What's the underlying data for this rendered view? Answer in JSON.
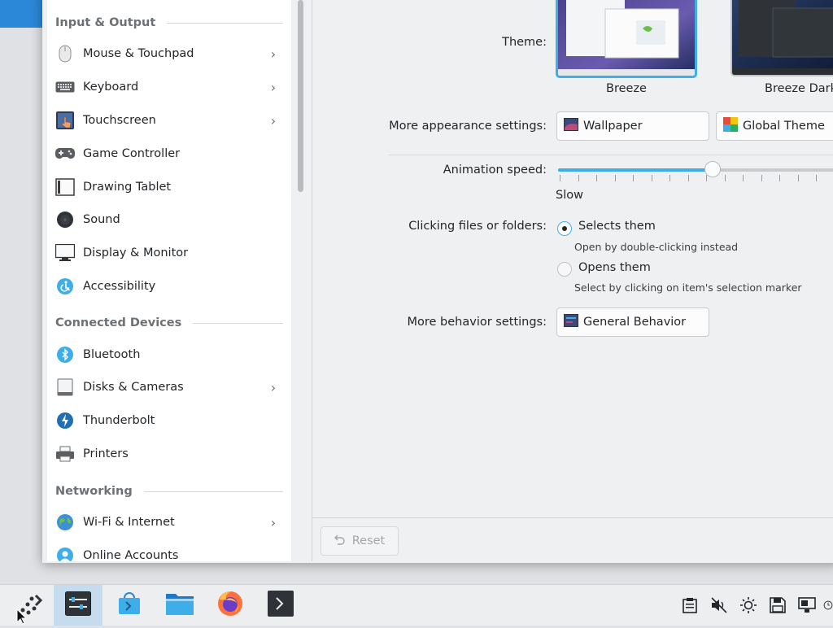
{
  "sidebar": {
    "sections": [
      {
        "title": "Input & Output"
      },
      {
        "title": "Connected Devices"
      },
      {
        "title": "Networking"
      }
    ],
    "items": [
      {
        "label": "Mouse & Touchpad",
        "icon": "mouse-icon",
        "has_children": true
      },
      {
        "label": "Keyboard",
        "icon": "keyboard-icon",
        "has_children": true
      },
      {
        "label": "Touchscreen",
        "icon": "touchscreen-icon",
        "has_children": true
      },
      {
        "label": "Game Controller",
        "icon": "gamepad-icon",
        "has_children": false
      },
      {
        "label": "Drawing Tablet",
        "icon": "tablet-icon",
        "has_children": false
      },
      {
        "label": "Sound",
        "icon": "speaker-icon",
        "has_children": false
      },
      {
        "label": "Display & Monitor",
        "icon": "monitor-icon",
        "has_children": false
      },
      {
        "label": "Accessibility",
        "icon": "accessibility-icon",
        "has_children": false
      },
      {
        "label": "Bluetooth",
        "icon": "bluetooth-icon",
        "has_children": false
      },
      {
        "label": "Disks & Cameras",
        "icon": "disk-icon",
        "has_children": true
      },
      {
        "label": "Thunderbolt",
        "icon": "thunderbolt-icon",
        "has_children": false
      },
      {
        "label": "Printers",
        "icon": "printer-icon",
        "has_children": false
      },
      {
        "label": "Wi-Fi & Internet",
        "icon": "globe-icon",
        "has_children": true
      },
      {
        "label": "Online Accounts",
        "icon": "accounts-icon",
        "has_children": false
      }
    ]
  },
  "main": {
    "theme_label": "Theme:",
    "themes": [
      {
        "name": "Breeze",
        "selected": true
      },
      {
        "name": "Breeze Dark",
        "selected": false
      }
    ],
    "more_appearance_label": "More appearance settings:",
    "wallpaper_button": "Wallpaper",
    "global_theme_button": "Global Theme",
    "animation_label": "Animation speed:",
    "animation_slow": "Slow",
    "animation_level": 0.55,
    "clicking_label": "Clicking files or folders:",
    "option_selects": "Selects them",
    "option_selects_hint": "Open by double-clicking instead",
    "option_opens": "Opens them",
    "option_opens_hint": "Select by clicking on item's selection marker",
    "selected_option": "selects",
    "more_behavior_label": "More behavior settings:",
    "general_behavior_button": "General Behavior"
  },
  "footer": {
    "reset_label": "Reset"
  },
  "taskbar": {
    "apps": [
      "application-launcher-icon",
      "system-settings-icon",
      "discover-icon",
      "dolphin-icon",
      "firefox-icon",
      "konsole-icon"
    ],
    "tray": [
      "clipboard-icon",
      "volume-muted-icon",
      "brightness-icon",
      "save-icon",
      "display-icon"
    ]
  },
  "colors": {
    "accent": "#3daee9",
    "window_bg": "#eff0f1",
    "sidebar_bg": "#ffffff"
  }
}
